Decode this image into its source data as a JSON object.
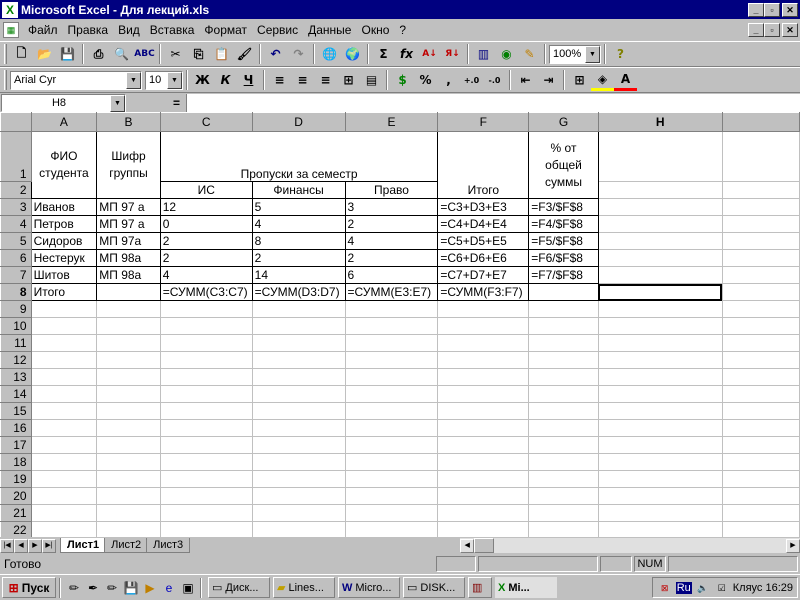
{
  "window": {
    "title": "Microsoft Excel - Для лекций.xls",
    "btn_min": "_",
    "btn_max": "▫",
    "btn_close": "✕"
  },
  "menu": [
    "Файл",
    "Правка",
    "Вид",
    "Вставка",
    "Формат",
    "Сервис",
    "Данные",
    "Окно",
    "?"
  ],
  "toolbar1": {
    "zoom": "100%"
  },
  "toolbar2": {
    "font": "Arial Cyr",
    "size": "10",
    "bold": "Ж",
    "italic": "К",
    "underline": "Ч",
    "percent": "%",
    "comma": ","
  },
  "formula_bar": {
    "name_box": "H8",
    "eq": "=",
    "content": ""
  },
  "grid": {
    "columns": [
      "A",
      "B",
      "C",
      "D",
      "E",
      "F",
      "G",
      "H"
    ],
    "rows": [
      "1",
      "2",
      "3",
      "4",
      "5",
      "6",
      "7",
      "8",
      "9",
      "10",
      "11",
      "12",
      "13",
      "14",
      "15",
      "16",
      "17",
      "18",
      "19",
      "20",
      "21",
      "22"
    ],
    "header": {
      "a1": "ФИО студента",
      "b1": "Шифр группы",
      "c1": "Пропуски за семестр",
      "c2": "ИС",
      "d2": "Финансы",
      "e2": "Право",
      "f2": "Итого",
      "g1": "% от общей суммы"
    },
    "data": [
      [
        "Иванов",
        "МП 97 а",
        "12",
        "5",
        "3",
        "=C3+D3+E3",
        "=F3/$F$8"
      ],
      [
        "Петров",
        "МП 97 а",
        "0",
        "4",
        "2",
        "=C4+D4+E4",
        "=F4/$F$8"
      ],
      [
        "Сидоров",
        "МП 97а",
        "2",
        "8",
        "4",
        "=C5+D5+E5",
        "=F5/$F$8"
      ],
      [
        "Нестерук",
        "МП 98а",
        "2",
        "2",
        "2",
        "=C6+D6+E6",
        "=F6/$F$8"
      ],
      [
        "Шитов",
        "МП 98а",
        "4",
        "14",
        "6",
        "=C7+D7+E7",
        "=F7/$F$8"
      ]
    ],
    "total_row": [
      "Итого",
      "",
      "=СУММ(C3:C7)",
      "=СУММ(D3:D7)",
      "=СУММ(E3:E7)",
      "=СУММ(F3:F7)",
      ""
    ]
  },
  "sheets": [
    "Лист1",
    "Лист2",
    "Лист3"
  ],
  "status": {
    "text": "Готово",
    "num": "NUM"
  },
  "taskbar": {
    "start": "Пуск",
    "buttons": [
      "Диск...",
      "Lines...",
      "Micro...",
      "DISK...",
      "Mi..."
    ],
    "lang": "Ru",
    "clock": "Кляус 16:29"
  }
}
